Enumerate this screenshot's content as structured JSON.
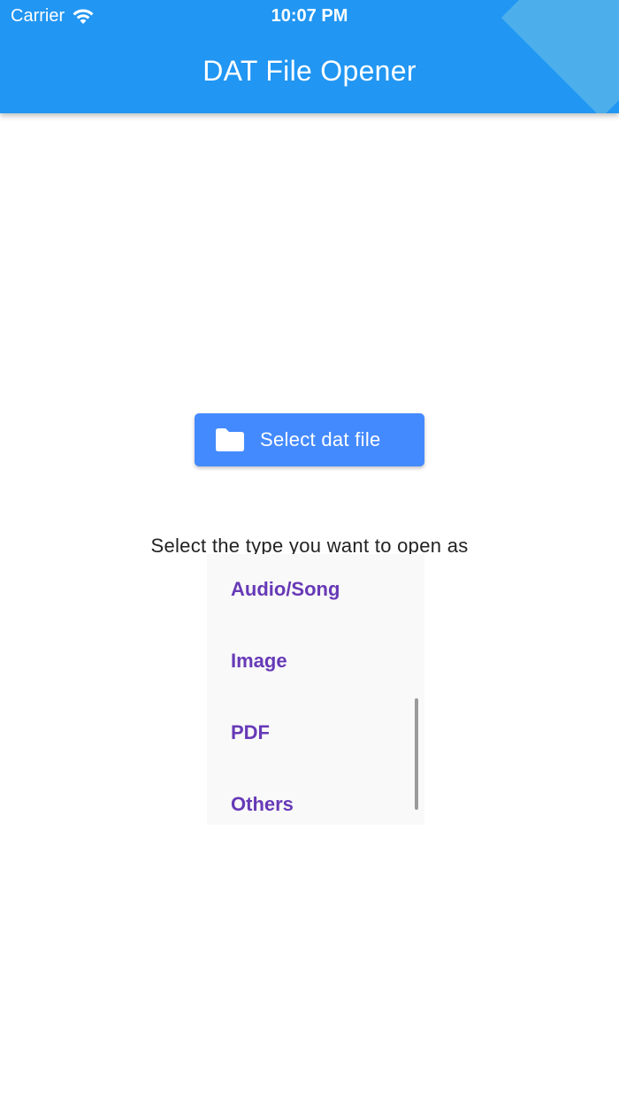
{
  "status_bar": {
    "carrier": "Carrier",
    "time": "10:07 PM"
  },
  "app_bar": {
    "title": "DAT File Opener",
    "color": "#2196F3"
  },
  "select_button": {
    "label": "Select dat file",
    "icon": "folder-icon",
    "color": "#448AFF"
  },
  "prompt": {
    "text": "Select the type you want to open as"
  },
  "dropdown": {
    "items": [
      {
        "label": "Audio/Song"
      },
      {
        "label": "Image"
      },
      {
        "label": "PDF"
      },
      {
        "label": "Others"
      }
    ],
    "item_color": "#673AB7"
  }
}
